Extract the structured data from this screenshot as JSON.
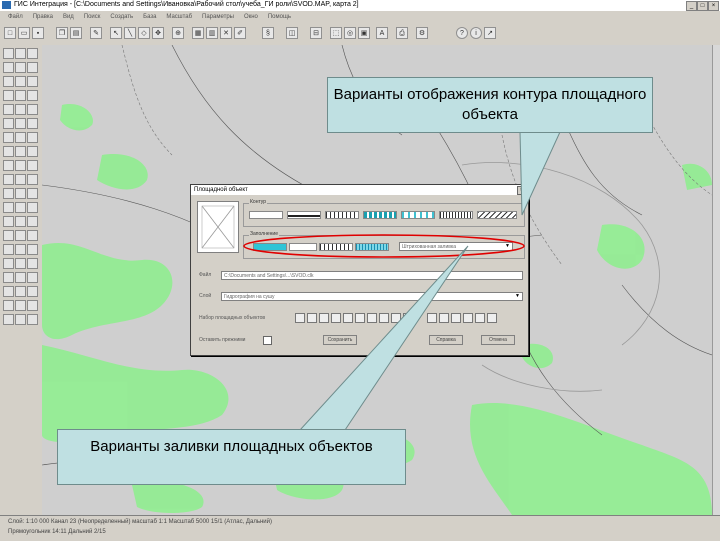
{
  "window": {
    "title": "ГИС Интеграция - [C:\\Documents and Settings\\Ивановка\\Рабочий стол\\учеба_ГИ роли\\SVOD.MAP, карта 2]"
  },
  "menu": {
    "items": [
      "Файл",
      "Правка",
      "Вид",
      "Поиск",
      "Создать",
      "База",
      "Масштаб",
      "Параметры",
      "Окно",
      "Помощь"
    ]
  },
  "dialog": {
    "title": "Площадной объект",
    "outline_group_label": "Контур",
    "fill_group_label": "Заполнение",
    "fill_select_value": "Штрихованная заливка",
    "file_label": "Файл",
    "file_value": "C:\\Documents and Settings\\...\\SVOD.clk",
    "layer_label": "Слой",
    "layer_value": "Гидрография на сушу",
    "objects_label": "Набор площадных объектов",
    "checkbox_label": "Оставить прежними",
    "buttons": {
      "ok": "Сохранить",
      "help": "Справка",
      "cancel": "Отмена"
    }
  },
  "callouts": {
    "outline": "Варианты отображения контура площадного объекта",
    "fill": "Варианты заливки площадных объектов"
  },
  "status": {
    "line1": "Слой: 1:10 000 Канал 23 (Неопределенный) масштаб 1:1 Масштаб 5000 15/1 (Атлас, Дальний)",
    "line2": "Прямоугольник 14:11 Дальний 2/15"
  },
  "colors": {
    "callout_fill": "#bfe0e2",
    "map_land": "#90ee90",
    "highlight_ellipse": "#e00000"
  }
}
